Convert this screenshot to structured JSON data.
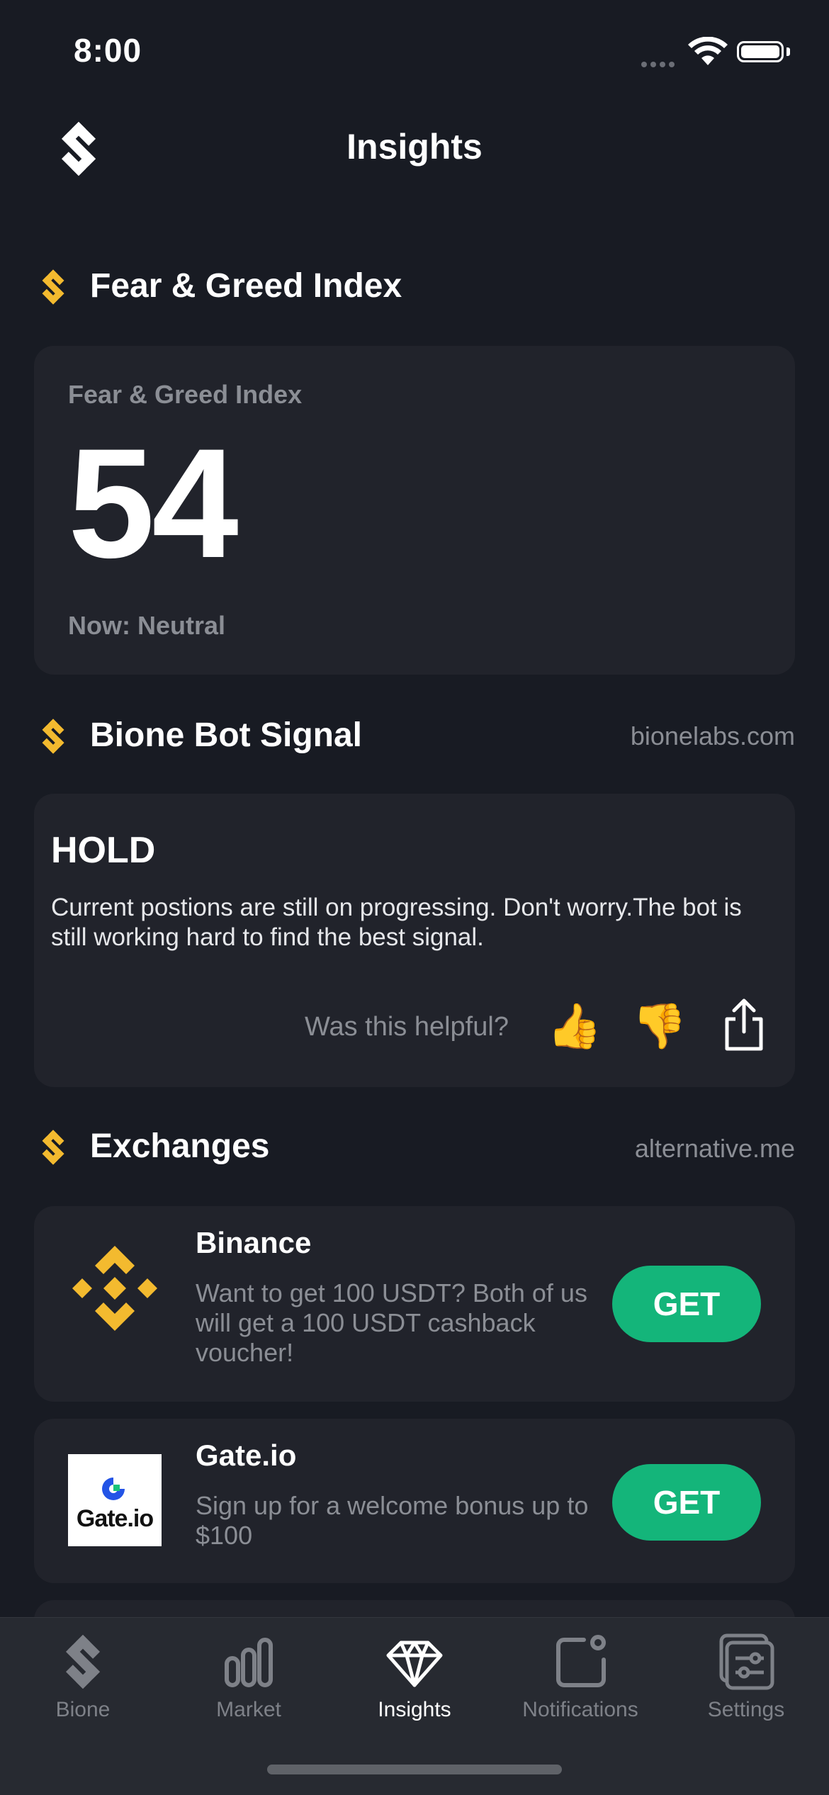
{
  "status_bar": {
    "time": "8:00"
  },
  "header": {
    "title": "Insights"
  },
  "fear_greed": {
    "section_title": "Fear & Greed Index",
    "card_label": "Fear & Greed Index",
    "value": "54",
    "status": "Now: Neutral"
  },
  "bot_signal": {
    "section_title": "Bione Bot Signal",
    "source": "bionelabs.com",
    "signal": "HOLD",
    "description": "Current postions are still on progressing. Don't worry.The bot is still working hard to find the best signal.",
    "helpful_prompt": "Was this helpful?",
    "thumbs_up": "👍",
    "thumbs_down": "👎"
  },
  "exchanges": {
    "section_title": "Exchanges",
    "source": "alternative.me",
    "items": [
      {
        "name": "Binance",
        "description": "Want to get 100 USDT? Both of us will get a 100 USDT cashback voucher!",
        "button": "GET"
      },
      {
        "name": "Gate.io",
        "logo_text": "Gate.io",
        "description": "Sign up for a welcome bonus up to $100",
        "button": "GET"
      }
    ]
  },
  "tabs": [
    {
      "label": "Bione",
      "icon": "bione-logo-icon",
      "active": false
    },
    {
      "label": "Market",
      "icon": "bar-chart-icon",
      "active": false
    },
    {
      "label": "Insights",
      "icon": "diamond-icon",
      "active": true
    },
    {
      "label": "Notifications",
      "icon": "notification-icon",
      "active": false
    },
    {
      "label": "Settings",
      "icon": "settings-sliders-icon",
      "active": false
    }
  ],
  "colors": {
    "background": "#181b23",
    "card": "#21232b",
    "accent_yellow": "#f3ba2f",
    "get_green": "#14b57a"
  }
}
